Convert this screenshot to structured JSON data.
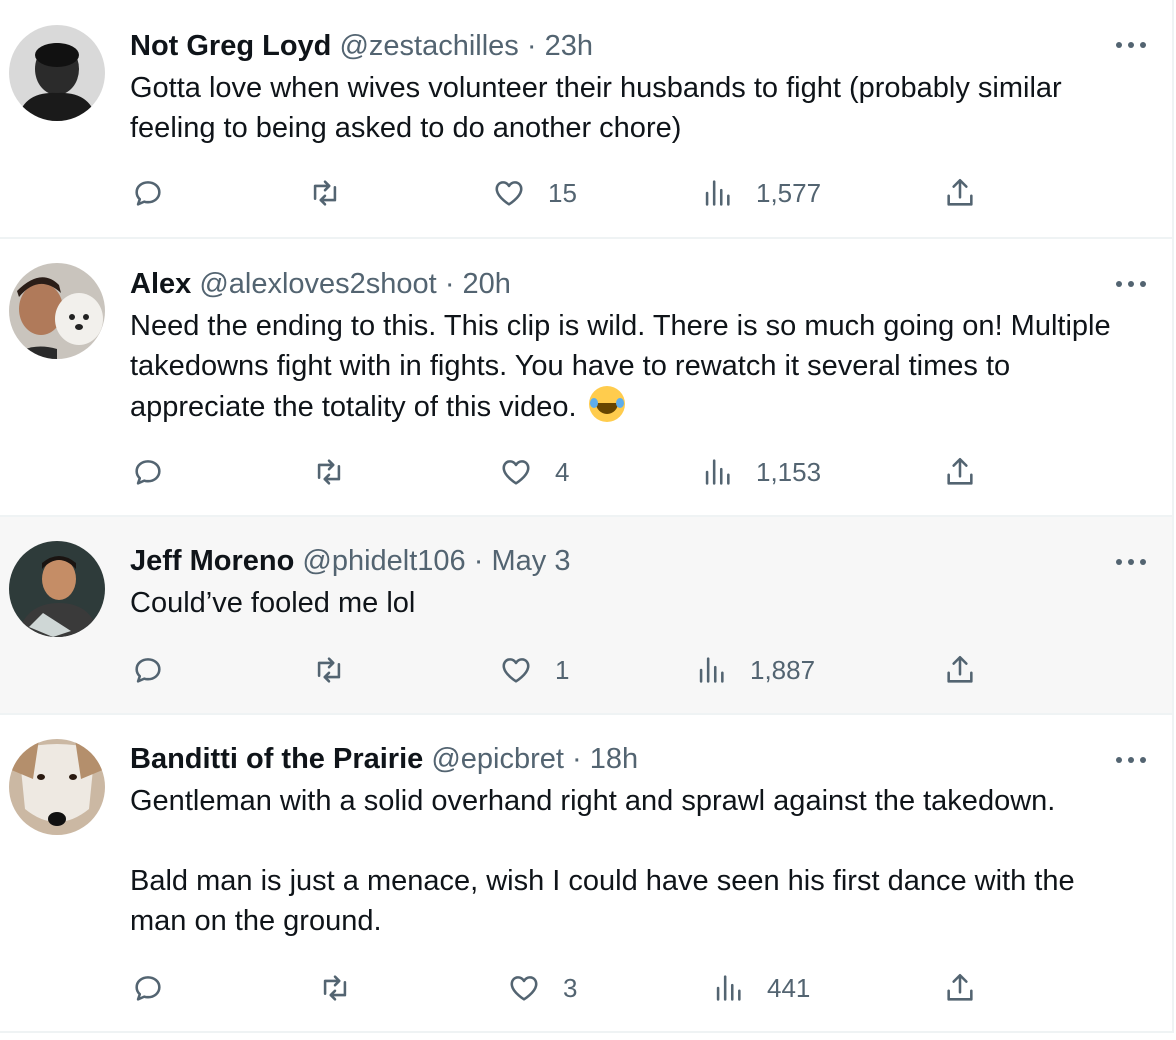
{
  "tweets": [
    {
      "name": "Not Greg Loyd",
      "handle": "@zestachilles",
      "separator": "·",
      "time": "23h",
      "body": [
        "Gotta love when wives volunteer their husbands to fight (probably similar feeling to being asked to do another chore)"
      ],
      "likes": "15",
      "views": "1,577",
      "highlighted": false
    },
    {
      "name": "Alex",
      "handle": "@alexloves2shoot",
      "separator": "·",
      "time": "20h",
      "body": [
        "Need the ending to this. This clip is wild. There is so much going on! Multiple takedowns fight with in fights. You have to rewatch it several times to appreciate the totality of this video."
      ],
      "emoji": "face-with-tears-of-joy",
      "likes": "4",
      "views": "1,153",
      "highlighted": false
    },
    {
      "name": "Jeff Moreno",
      "handle": "@phidelt106",
      "separator": "·",
      "time": "May 3",
      "body": [
        "Could’ve fooled me lol"
      ],
      "likes": "1",
      "views": "1,887",
      "highlighted": true
    },
    {
      "name": "Banditti of the Prairie",
      "handle": "@epicbret",
      "separator": "·",
      "time": "18h",
      "body": [
        "Gentleman with a solid overhand right and sprawl against the takedown.",
        "Bald man is just a menace, wish I could have seen his first dance with the man on the ground."
      ],
      "likes": "3",
      "views": "441",
      "highlighted": false
    }
  ],
  "icons": {
    "reply": "reply-bubble-icon",
    "retweet": "retweet-arrows-icon",
    "like": "heart-icon",
    "views": "bar-chart-icon",
    "share": "share-upload-icon",
    "more": "more-dots-icon"
  },
  "colors": {
    "text": "#0f1419",
    "secondary": "#536471",
    "divider": "#eff3f4",
    "highlight_bg": "#f7f7f7"
  }
}
